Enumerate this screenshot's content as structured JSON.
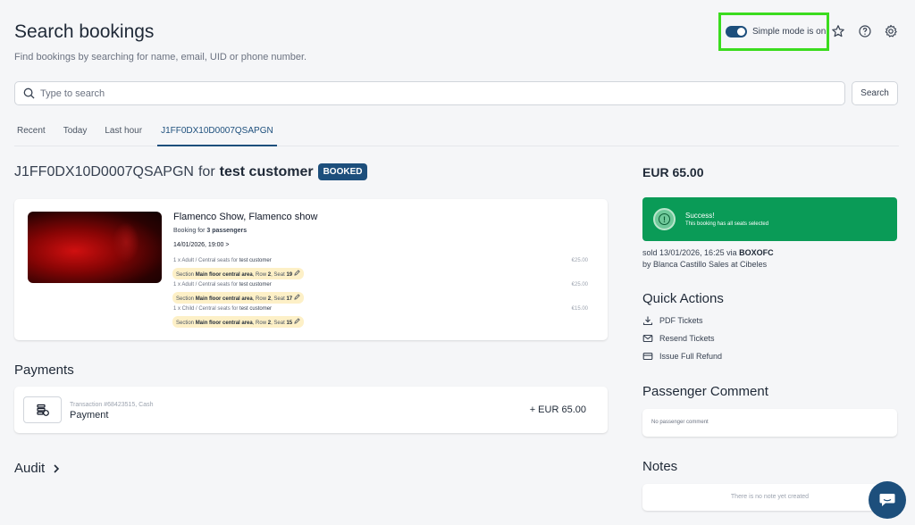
{
  "header": {
    "title": "Search bookings",
    "subtitle": "Find bookings by searching for name, email, UID or phone number.",
    "simple_mode_label": "Simple mode is on"
  },
  "search": {
    "placeholder": "Type to search",
    "button": "Search"
  },
  "tabs": [
    "Recent",
    "Today",
    "Last hour",
    "J1FF0DX10D0007QSAPGN"
  ],
  "booking": {
    "code": "J1FF0DX10D0007QSAPGN",
    "for_word": "for",
    "customer": "test customer",
    "status": "BOOKED"
  },
  "event": {
    "title": "Flamenco Show, Flamenco show",
    "booking_for_prefix": "Booking for",
    "passengers": "3 passengers",
    "datetime": "14/01/2026, 19:00 >",
    "tickets": [
      {
        "desc": "1 x Adult / Central seats for",
        "customer": "test customer",
        "price": "€25.00",
        "section_prefix": "Section",
        "section": "Main floor central area",
        "row_prefix": ", Row",
        "row": "2",
        "seat_prefix": ", Seat",
        "seat": "19"
      },
      {
        "desc": "1 x Adult / Central seats for",
        "customer": "test customer",
        "price": "€25.00",
        "section_prefix": "Section",
        "section": "Main floor central area",
        "row_prefix": ", Row",
        "row": "2",
        "seat_prefix": ", Seat",
        "seat": "17"
      },
      {
        "desc": "1 x Child / Central seats for",
        "customer": "test customer",
        "price": "€15.00",
        "section_prefix": "Section",
        "section": "Main floor central area",
        "row_prefix": ", Row",
        "row": "2",
        "seat_prefix": ", Seat",
        "seat": "15"
      }
    ]
  },
  "payments": {
    "heading": "Payments",
    "transaction": "Transaction #68423515, Cash",
    "label": "Payment",
    "amount": "+ EUR 65.00"
  },
  "audit": {
    "heading": "Audit"
  },
  "summary": {
    "total": "EUR 65.00",
    "success_title": "Success!",
    "success_text": "This booking has all seats selected",
    "sold_prefix": "sold 13/01/2026, 16:25 via",
    "sold_channel": "BOXOFC",
    "sold_by": "by Blanca Castillo Sales at Cibeles"
  },
  "quick_actions": {
    "heading": "Quick Actions",
    "items": [
      {
        "label": "PDF Tickets",
        "icon": "download-icon"
      },
      {
        "label": "Resend Tickets",
        "icon": "mail-icon"
      },
      {
        "label": "Issue Full Refund",
        "icon": "credit-card-icon"
      }
    ]
  },
  "comment": {
    "heading": "Passenger Comment",
    "text": "No passenger comment"
  },
  "notes": {
    "heading": "Notes",
    "text": "There is no note yet created"
  },
  "colors": {
    "primary": "#1d4f7c",
    "success": "#0a9b57",
    "highlight": "#3bdc1e",
    "seat_tag": "#fdf0c7"
  }
}
